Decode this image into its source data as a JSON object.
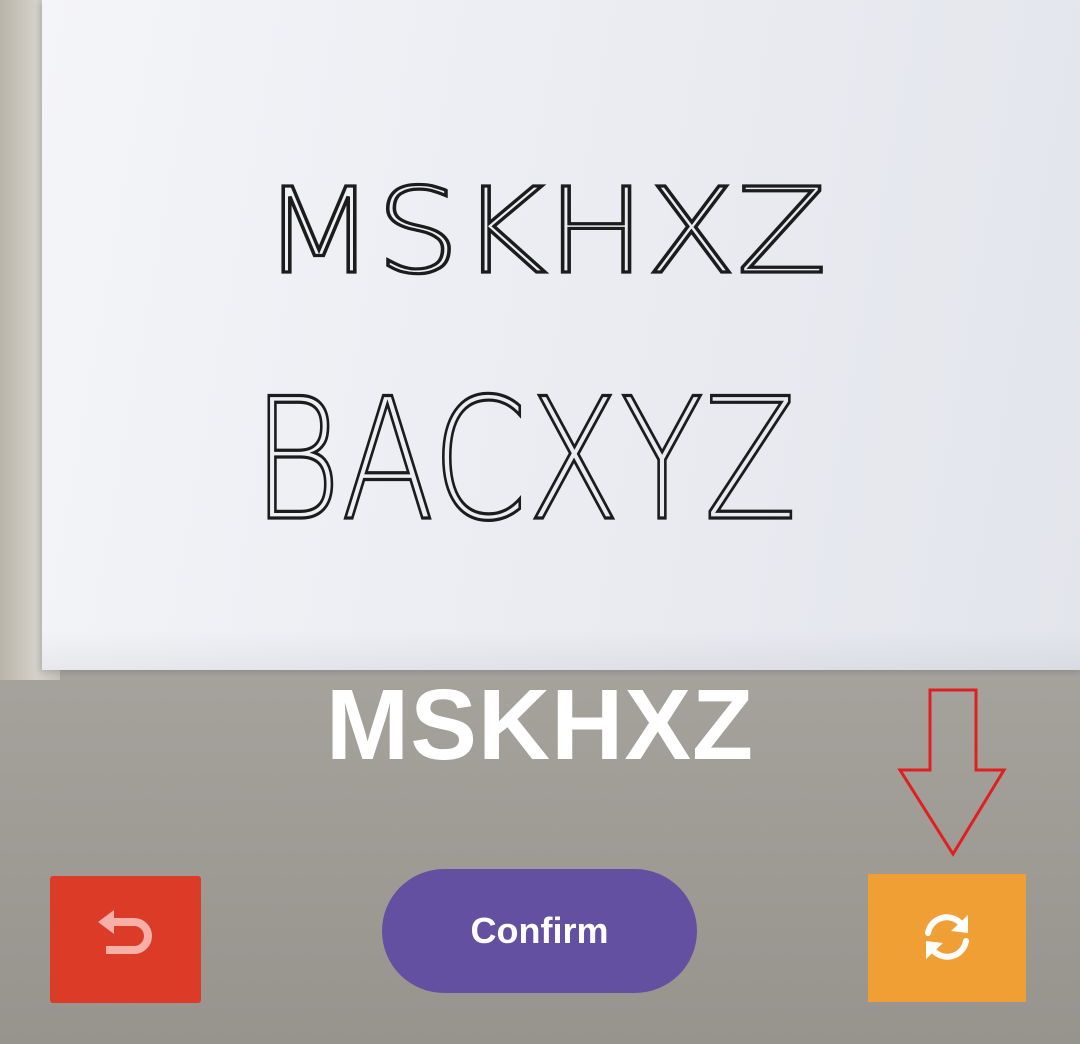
{
  "camera": {
    "handwritten_lines": [
      "MSKHXZ",
      "BACXYZ"
    ]
  },
  "result": {
    "recognized_text": "MSKHXZ"
  },
  "actions": {
    "undo_icon": "undo-arrow-icon",
    "confirm_label": "Confirm",
    "refresh_icon": "refresh-icon"
  },
  "colors": {
    "undo": "#dc3b27",
    "confirm": "#6450a1",
    "refresh": "#f09f35",
    "annotation": "#e02020"
  }
}
